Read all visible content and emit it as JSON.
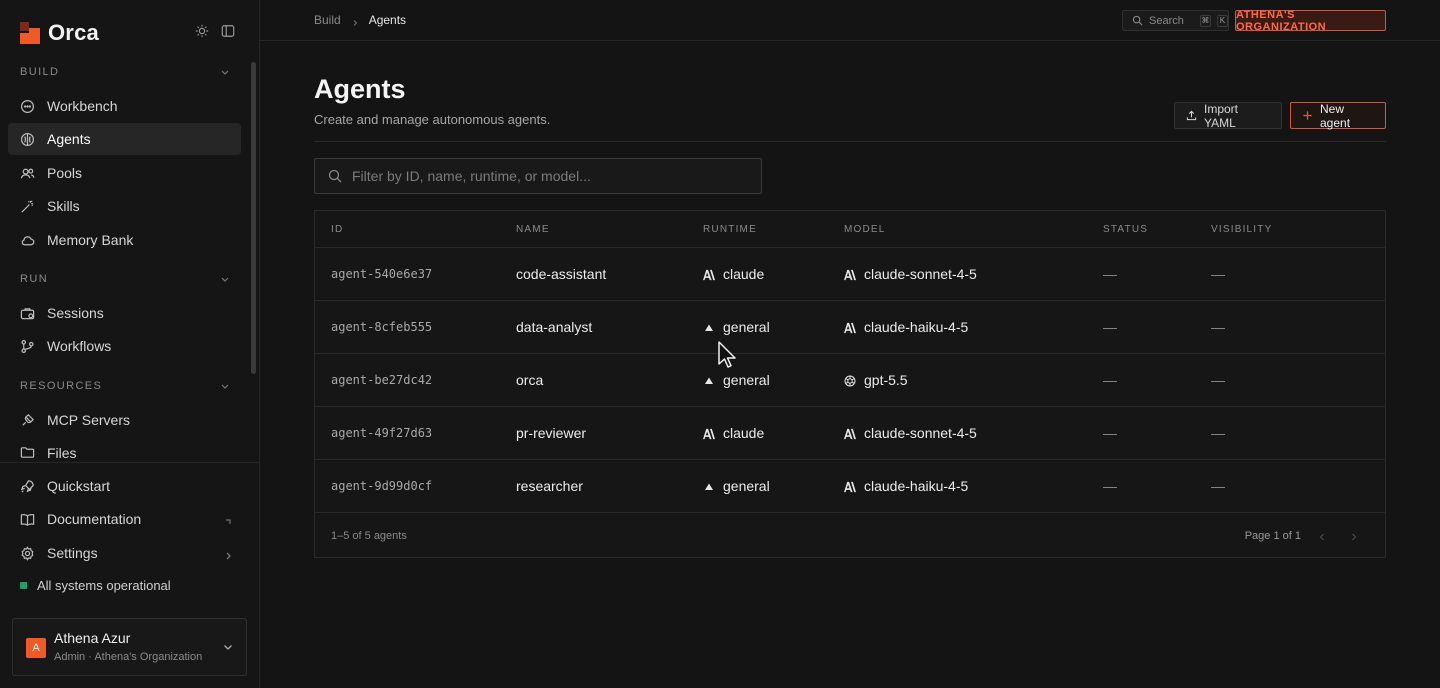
{
  "app": {
    "name": "Orca",
    "colors": {
      "accent": "#f05a28",
      "status_ok": "#22a06b",
      "bg": "#141414"
    }
  },
  "sidebar": {
    "sections": [
      {
        "title": "BUILD",
        "items": [
          {
            "label": "Workbench",
            "icon": "chat-icon"
          },
          {
            "label": "Agents",
            "icon": "brain-icon",
            "active": true
          },
          {
            "label": "Pools",
            "icon": "users-icon"
          },
          {
            "label": "Skills",
            "icon": "wand-icon"
          },
          {
            "label": "Memory Bank",
            "icon": "cloud-icon"
          }
        ]
      },
      {
        "title": "RUN",
        "items": [
          {
            "label": "Sessions",
            "icon": "briefcase-icon"
          },
          {
            "label": "Workflows",
            "icon": "git-branch-icon"
          }
        ]
      },
      {
        "title": "RESOURCES",
        "items": [
          {
            "label": "MCP Servers",
            "icon": "plug-icon"
          },
          {
            "label": "Files",
            "icon": "folder-icon"
          }
        ]
      }
    ],
    "footer_items": [
      {
        "label": "Quickstart",
        "icon": "rocket-icon"
      },
      {
        "label": "Documentation",
        "icon": "book-icon"
      },
      {
        "label": "Settings",
        "icon": "gear-icon"
      }
    ],
    "status": "All systems operational",
    "user": {
      "initial": "A",
      "name": "Athena Azur",
      "subtitle": "Admin · Athena's Organization"
    }
  },
  "topbar": {
    "breadcrumb": [
      "Build",
      "Agents"
    ],
    "search_label": "Search",
    "search_keys": [
      "⌘",
      "K"
    ],
    "org_badge": "ATHENA'S ORGANIZATION"
  },
  "main": {
    "title": "Agents",
    "subtitle": "Create and manage autonomous agents.",
    "import_label": "Import YAML",
    "new_label": "New agent",
    "filter_placeholder": "Filter by ID, name, runtime, or model...",
    "columns": [
      "ID",
      "NAME",
      "RUNTIME",
      "MODEL",
      "STATUS",
      "VISIBILITY"
    ],
    "rows": [
      {
        "id": "agent-540e6e37",
        "name": "code-assistant",
        "runtime": "claude",
        "runtime_icon": "anthropic-icon",
        "model": "claude-sonnet-4-5",
        "model_icon": "anthropic-icon",
        "status": "—",
        "visibility": "—"
      },
      {
        "id": "agent-8cfeb555",
        "name": "data-analyst",
        "runtime": "general",
        "runtime_icon": "triangle-icon",
        "model": "claude-haiku-4-5",
        "model_icon": "anthropic-icon",
        "status": "—",
        "visibility": "—"
      },
      {
        "id": "agent-be27dc42",
        "name": "orca",
        "runtime": "general",
        "runtime_icon": "triangle-icon",
        "model": "gpt-5.5",
        "model_icon": "openai-icon",
        "status": "—",
        "visibility": "—"
      },
      {
        "id": "agent-49f27d63",
        "name": "pr-reviewer",
        "runtime": "claude",
        "runtime_icon": "anthropic-icon",
        "model": "claude-sonnet-4-5",
        "model_icon": "anthropic-icon",
        "status": "—",
        "visibility": "—"
      },
      {
        "id": "agent-9d99d0cf",
        "name": "researcher",
        "runtime": "general",
        "runtime_icon": "triangle-icon",
        "model": "claude-haiku-4-5",
        "model_icon": "anthropic-icon",
        "status": "—",
        "visibility": "—"
      }
    ],
    "count_text": "1–5 of 5 agents",
    "page_text": "Page 1 of 1"
  }
}
